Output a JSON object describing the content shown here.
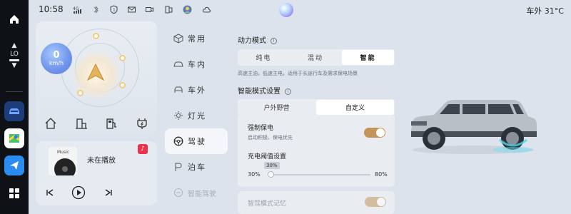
{
  "status": {
    "time": "10:58",
    "icons": [
      "signal-4g-icon",
      "bluetooth-icon",
      "shield-icon",
      "message-icon",
      "camera-icon",
      "phone-link-icon",
      "avatar-icon",
      "cloud-icon"
    ],
    "outside_temp": "车外 31°C"
  },
  "dock": {
    "hvac_level": "LO",
    "apps": [
      "home-icon",
      "climate-control",
      "vehicle-app-icon",
      "maps-app-icon",
      "send-app-icon",
      "app-grid-icon"
    ]
  },
  "speed_widget": {
    "speed": "0",
    "unit": "km/h",
    "shortcuts": [
      "home-shortcut-icon",
      "parking-shortcut-icon",
      "fuel-shortcut-icon",
      "charging-shortcut-icon"
    ]
  },
  "music": {
    "album_label": "Music",
    "status": "未在播放",
    "controls": [
      "previous-icon",
      "play-icon",
      "next-icon"
    ]
  },
  "nav": {
    "items": [
      {
        "label": "常用",
        "icon": "cube-icon"
      },
      {
        "label": "车内",
        "icon": "car-interior-icon"
      },
      {
        "label": "车外",
        "icon": "car-exterior-icon"
      },
      {
        "label": "灯光",
        "icon": "light-icon"
      },
      {
        "label": "驾驶",
        "icon": "steering-wheel-icon",
        "active": true
      },
      {
        "label": "泊车",
        "icon": "parking-icon"
      },
      {
        "label": "智能驾驶",
        "icon": "smart-drive-icon",
        "faded": true
      }
    ]
  },
  "power_mode": {
    "title": "动力模式",
    "options": [
      "纯电",
      "混动",
      "智能"
    ],
    "selected": "智能",
    "description": "高速主油，低速主电，适用于长途行车及需求保电场景"
  },
  "smart_mode": {
    "title": "智能模式设置",
    "options": [
      "户外野营",
      "自定义"
    ],
    "selected": "自定义",
    "force_save_title": "强制保电",
    "force_save_desc": "启动积极、保电优先",
    "force_save_on": true,
    "threshold_title": "充电阈值设置",
    "threshold_value": "30%",
    "threshold_min": "30%",
    "threshold_max": "80%",
    "threshold_fraction": 0
  },
  "next_row": {
    "label": "智驾模式记忆",
    "on": true
  },
  "colors": {
    "accent": "#c4955a",
    "dock_bg": "#0e1116",
    "page_bg": "#dde3ec"
  }
}
